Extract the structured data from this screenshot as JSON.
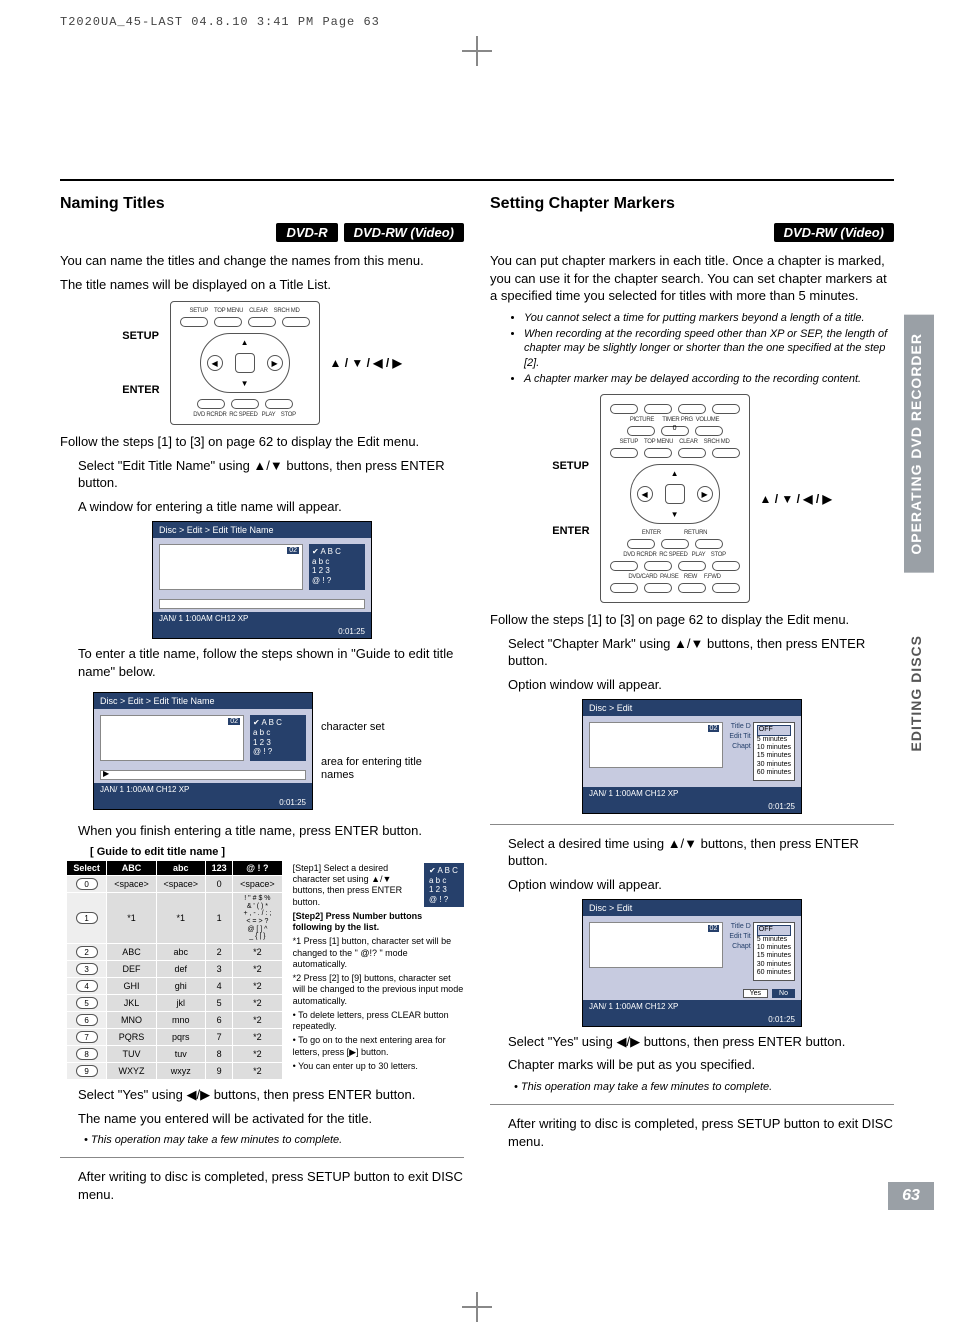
{
  "runhead": "T2020UA_45-LAST  04.8.10 3:41 PM  Page 63",
  "page_number": "63",
  "side_tab_dark": "OPERATING DVD RECORDER",
  "side_tab_light": "EDITING DISCS",
  "arrows": "▲ / ▼ / ◀ / ▶",
  "remote_labels": {
    "setup": "SETUP",
    "enter": "ENTER"
  },
  "remote_top_btn_labels": [
    "SETUP",
    "TOP MENU",
    "CLEAR",
    "SRCH MD"
  ],
  "left": {
    "heading": "Naming Titles",
    "badges": [
      "DVD-R",
      "DVD-RW (Video)"
    ],
    "intro1": "You can name the titles and change the names from this menu.",
    "intro2": "The title names will be displayed on a Title List.",
    "after_remote": "Follow the steps [1] to [3] on page 62 to display the Edit menu.",
    "step_a": "Select \"Edit Title Name\" using ▲/▼ buttons, then press ENTER button.",
    "step_a2": "A window for entering a title name will appear.",
    "step_b": "To enter a title name, follow the steps shown in \"Guide to edit title name\" below.",
    "step_c": "When you finish entering a title name, press ENTER button.",
    "osd_title": "Disc > Edit > Edit Title Name",
    "charset": [
      "A B C",
      "a b c",
      "1 2 3",
      "@ ! ?"
    ],
    "osd_status": "JAN/ 1   1:00AM   CH12   XP",
    "osd_timebar": "0:01:25",
    "annot_charset": "character set",
    "annot_area": "area for entering title names",
    "guide_title": "[ Guide to edit title name ]",
    "tbl_head": [
      "Select",
      "ABC",
      "abc",
      "123",
      "@ ! ?"
    ],
    "tbl_rows": [
      [
        "0",
        "<space>",
        "<space>",
        "0",
        "<space>"
      ],
      [
        "1",
        "*1",
        "*1",
        "1",
        "! \" # $ %\n& ' ( ) *\n+ , - . / : ;\n< = > ?\n@ [ ] ^\n_ { | }"
      ],
      [
        "2",
        "ABC",
        "abc",
        "2",
        "*2"
      ],
      [
        "3",
        "DEF",
        "def",
        "3",
        "*2"
      ],
      [
        "4",
        "GHI",
        "ghi",
        "4",
        "*2"
      ],
      [
        "5",
        "JKL",
        "jkl",
        "5",
        "*2"
      ],
      [
        "6",
        "MNO",
        "mno",
        "6",
        "*2"
      ],
      [
        "7",
        "PQRS",
        "pqrs",
        "7",
        "*2"
      ],
      [
        "8",
        "TUV",
        "tuv",
        "8",
        "*2"
      ],
      [
        "9",
        "WXYZ",
        "wxyz",
        "9",
        "*2"
      ]
    ],
    "guide_step1": "[Step1] Select a desired character set using ▲/▼ buttons, then press ENTER button.",
    "guide_step2": "[Step2] Press Number buttons following by the list.",
    "guide_n1": "*1 Press [1] button, character set will be changed to the \" @!? \" mode automatically.",
    "guide_n2": "*2 Press [2] to [9] buttons, character set will be changed to the previous input mode automatically.",
    "guide_n3": "• To delete letters, press CLEAR button repeatedly.",
    "guide_n4": "• To go on to the next entering area for letters, press [▶] button.",
    "guide_n5": "• You can enter up to 30 letters.",
    "step_d": "Select \"Yes\" using ◀/▶ buttons, then press ENTER button.",
    "step_d2": "The name you entered will be activated for the title.",
    "note1": "• This operation may take a few minutes to complete.",
    "step_e": "After writing to disc is completed, press SETUP button to exit DISC menu."
  },
  "right": {
    "heading": "Setting Chapter Markers",
    "badges": [
      "DVD-RW (Video)"
    ],
    "intro": "You can put chapter markers in each title. Once a chapter is marked, you can use it for the chapter search. You can set chapter markers at a specified time you selected for titles with more than 5 minutes.",
    "notes_top": [
      "You cannot select a time for putting markers beyond a length of a title.",
      "When recording at the recording speed other than XP or SEP, the length of chapter may be slightly longer or shorter than the one specified at the step [2].",
      "A chapter marker may be delayed according to the recording content."
    ],
    "after_remote": "Follow the steps [1] to [3] on page 62 to display the Edit menu.",
    "step_a": "Select \"Chapter Mark\" using ▲/▼ buttons, then press ENTER button.",
    "step_a2": "Option window will appear.",
    "osd_title": "Disc > Edit",
    "edit_labels": [
      "Title D",
      "Edit Tit",
      "Chapt"
    ],
    "options": [
      "OFF",
      "5 minutes",
      "10 minutes",
      "15 minutes",
      "30 minutes",
      "60 minutes"
    ],
    "osd_status": "JAN/ 1   1:00AM   CH12    XP",
    "osd_timebar": "0:01:25",
    "step_b": "Select a desired time using ▲/▼ buttons, then press ENTER button.",
    "step_b2": "Option window will appear.",
    "yn_yes": "Yes",
    "yn_no": "No",
    "step_c": "Select \"Yes\" using ◀/▶ buttons, then press ENTER button.",
    "step_c2": "Chapter marks will be put as you specified.",
    "note1": "• This operation may take a few minutes to complete.",
    "step_d": "After writing to disc is completed, press SETUP button to exit DISC menu."
  }
}
